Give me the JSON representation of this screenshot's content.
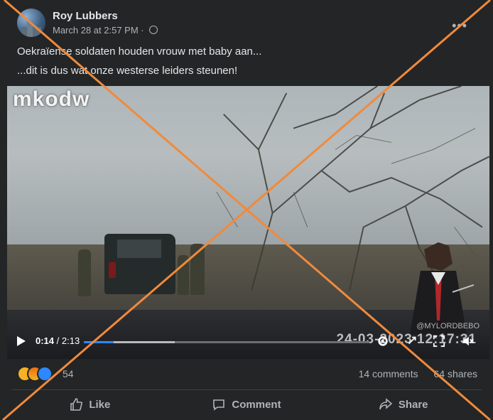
{
  "post": {
    "author": "Roy Lubbers",
    "timestamp": "March 28 at 2:57 PM",
    "separator": "·",
    "text_line1": "Oekraïense soldaten houden vrouw met baby aan...",
    "text_line2": "...dit is dus wat onze westerse leiders steunen!"
  },
  "video": {
    "watermark": "mkodw",
    "overlay_timestamp": "24-03-2023 12:17:31",
    "overlay_handle": "@MYLORDBEBO",
    "current_time": "0:14",
    "duration": "/ 2:13",
    "progress_fraction": 0.105,
    "buffered_fraction": 0.318
  },
  "reactions": {
    "count": "54",
    "icons": [
      "sad-emoji",
      "angry-emoji",
      "care-emoji"
    ]
  },
  "stats": {
    "comments": "14 comments",
    "shares": "64 shares"
  },
  "actions": {
    "like": "Like",
    "comment": "Comment",
    "share": "Share"
  },
  "overlay": {
    "cross_color": "#f08a3c"
  }
}
